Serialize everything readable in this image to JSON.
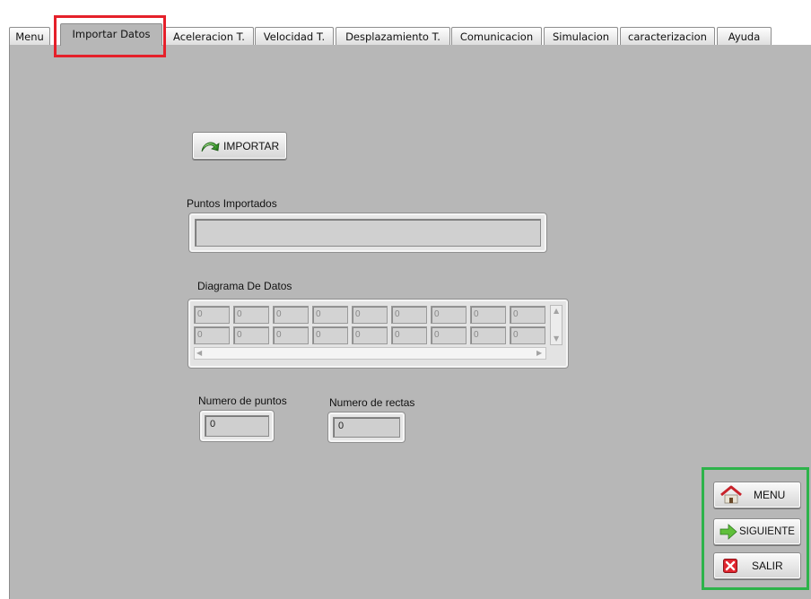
{
  "tabs": [
    {
      "label": "Menu"
    },
    {
      "label": "Importar Datos"
    },
    {
      "label": "Aceleracion T."
    },
    {
      "label": "Velocidad T."
    },
    {
      "label": "Desplazamiento T."
    },
    {
      "label": "Comunicacion"
    },
    {
      "label": "Simulacion"
    },
    {
      "label": "caracterizacion"
    },
    {
      "label": "Ayuda"
    }
  ],
  "active_tab": "Importar Datos",
  "import_button": {
    "label": "IMPORTAR",
    "icon": "green-curved-arrow-icon"
  },
  "puntos_importados": {
    "label": "Puntos Importados",
    "value": ""
  },
  "diagrama": {
    "label": "Diagrama De Datos",
    "rows": [
      [
        "0",
        "0",
        "0",
        "0",
        "0",
        "0",
        "0",
        "0",
        "0"
      ],
      [
        "0",
        "0",
        "0",
        "0",
        "0",
        "0",
        "0",
        "0",
        "0"
      ]
    ]
  },
  "numero_puntos": {
    "label": "Numero de puntos",
    "value": "0"
  },
  "numero_rectas": {
    "label": "Numero de rectas",
    "value": "0"
  },
  "nav_buttons": {
    "menu": {
      "label": "MENU",
      "icon": "house-icon"
    },
    "siguiente": {
      "label": "SIGUIENTE",
      "icon": "green-right-arrow-icon"
    },
    "salir": {
      "label": "SALIR",
      "icon": "red-x-icon"
    }
  },
  "colors": {
    "panel_bg": "#b7b7b7",
    "highlight_red": "#e5202a",
    "highlight_green": "#2db34a"
  }
}
